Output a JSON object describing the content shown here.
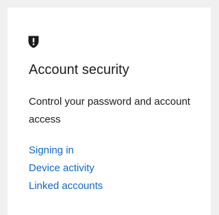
{
  "card": {
    "icon": "shield-icon",
    "title": "Account security",
    "description": "Control your password and account access",
    "links": [
      {
        "label": "Signing in"
      },
      {
        "label": "Device activity"
      },
      {
        "label": "Linked accounts"
      }
    ]
  },
  "colors": {
    "background": "#f0f0f0",
    "card": "#ffffff",
    "text": "#1c1c1c",
    "link": "#1166cc"
  }
}
